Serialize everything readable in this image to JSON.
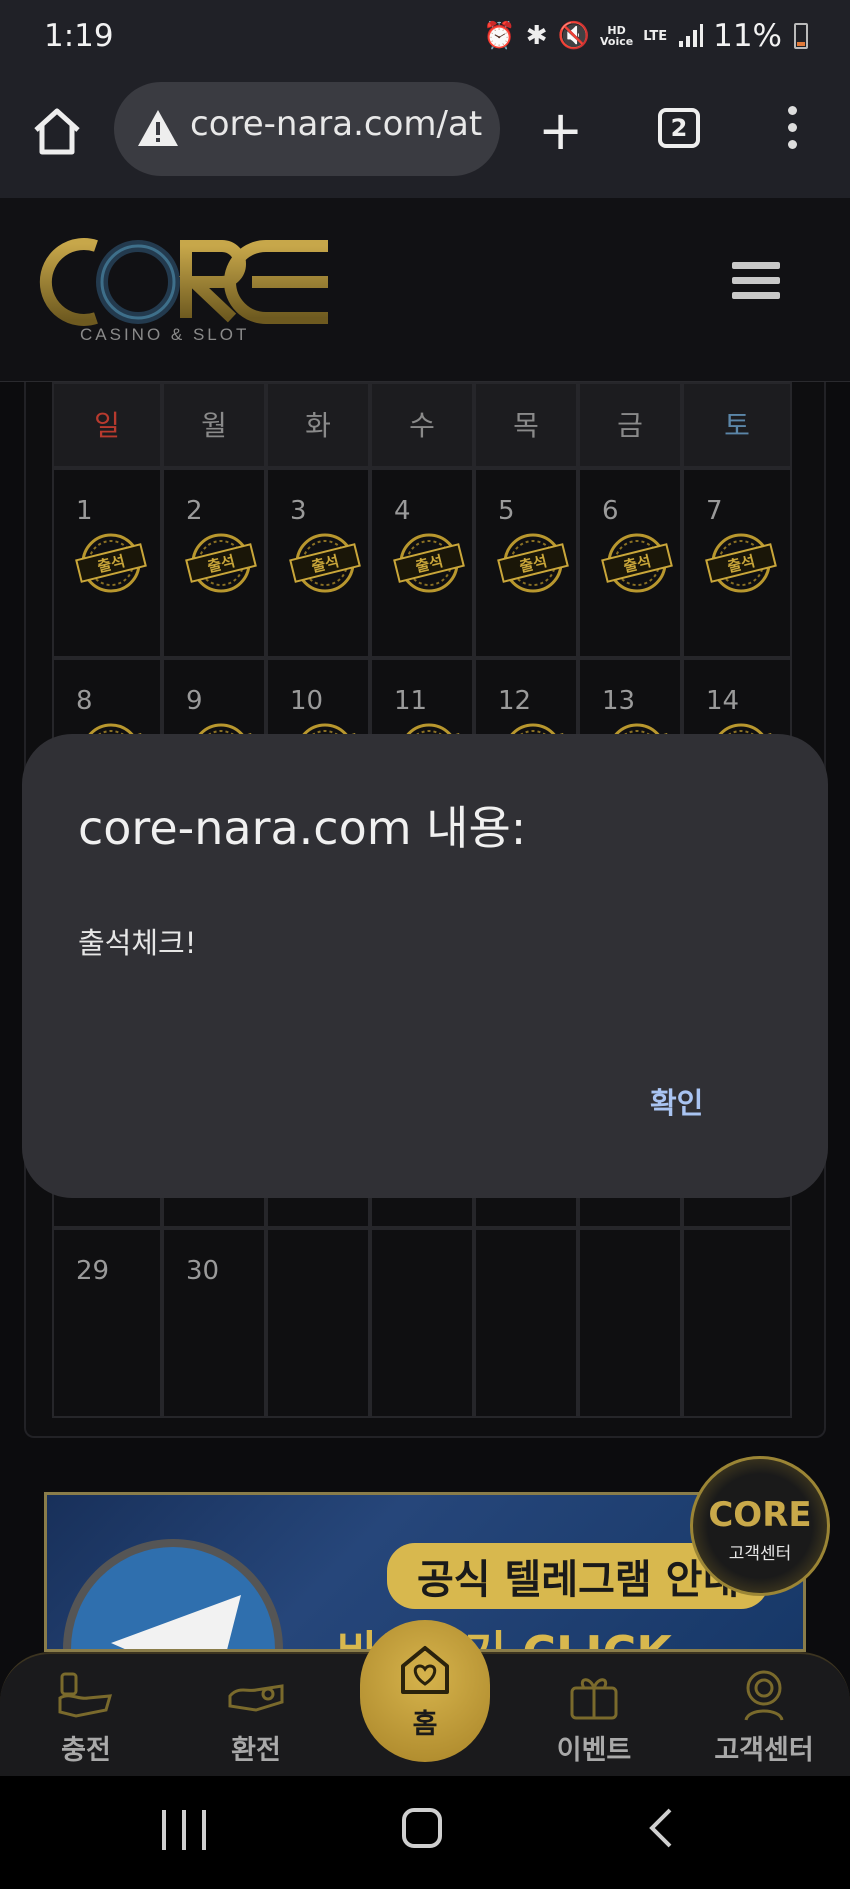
{
  "status": {
    "time": "1:19",
    "hd_label": "HD",
    "voice_label": "Voice",
    "lte_label": "LTE",
    "battery": "11%"
  },
  "browser": {
    "url": "core-nara.com/at",
    "tab_count": "2"
  },
  "site": {
    "logo_text": "CORE",
    "logo_sub": "CASINO & SLOT"
  },
  "calendar": {
    "weekdays": [
      "일",
      "월",
      "화",
      "수",
      "목",
      "금",
      "토"
    ],
    "weekday_colors": [
      "#b83a2e",
      "#8a8a8a",
      "#8a8a8a",
      "#8a8a8a",
      "#8a8a8a",
      "#8a8a8a",
      "#5b86a8"
    ],
    "stamp_label": "출석",
    "rows": [
      [
        {
          "d": "1",
          "s": true
        },
        {
          "d": "2",
          "s": true
        },
        {
          "d": "3",
          "s": true
        },
        {
          "d": "4",
          "s": true
        },
        {
          "d": "5",
          "s": true
        },
        {
          "d": "6",
          "s": true
        },
        {
          "d": "7",
          "s": true
        }
      ],
      [
        {
          "d": "8",
          "s": true
        },
        {
          "d": "9",
          "s": true
        },
        {
          "d": "10",
          "s": true
        },
        {
          "d": "11",
          "s": true
        },
        {
          "d": "12",
          "s": true
        },
        {
          "d": "13",
          "s": true
        },
        {
          "d": "14",
          "s": true
        }
      ],
      [
        {
          "d": "",
          "s": false
        },
        {
          "d": "",
          "s": false
        },
        {
          "d": "",
          "s": false
        },
        {
          "d": "",
          "s": false
        },
        {
          "d": "",
          "s": false
        },
        {
          "d": "",
          "s": false
        },
        {
          "d": "",
          "s": false
        }
      ],
      [
        {
          "d": "",
          "s": false
        },
        {
          "d": "",
          "s": false
        },
        {
          "d": "",
          "s": false
        },
        {
          "d": "",
          "s": false
        },
        {
          "d": "",
          "s": false
        },
        {
          "d": "",
          "s": false
        },
        {
          "d": "",
          "s": false
        }
      ],
      [
        {
          "d": "29",
          "s": false
        },
        {
          "d": "30",
          "s": false
        },
        {
          "d": "",
          "s": false
        },
        {
          "d": "",
          "s": false
        },
        {
          "d": "",
          "s": false
        },
        {
          "d": "",
          "s": false
        },
        {
          "d": "",
          "s": false
        }
      ]
    ]
  },
  "dialog": {
    "title": "core-nara.com 내용:",
    "message": "출석체크!",
    "confirm_label": "확인"
  },
  "banner": {
    "line1": "공식 텔레그램 안내",
    "line2": "바로가기 CLICK"
  },
  "floating_cs": {
    "logo": "CORE",
    "label": "고객센터"
  },
  "bottom_nav": {
    "items": [
      "충전",
      "환전",
      "홈",
      "이벤트",
      "고객센터"
    ]
  },
  "colors": {
    "accent_gold": "#d6b34c",
    "dialog_button": "#a9c4f2"
  }
}
